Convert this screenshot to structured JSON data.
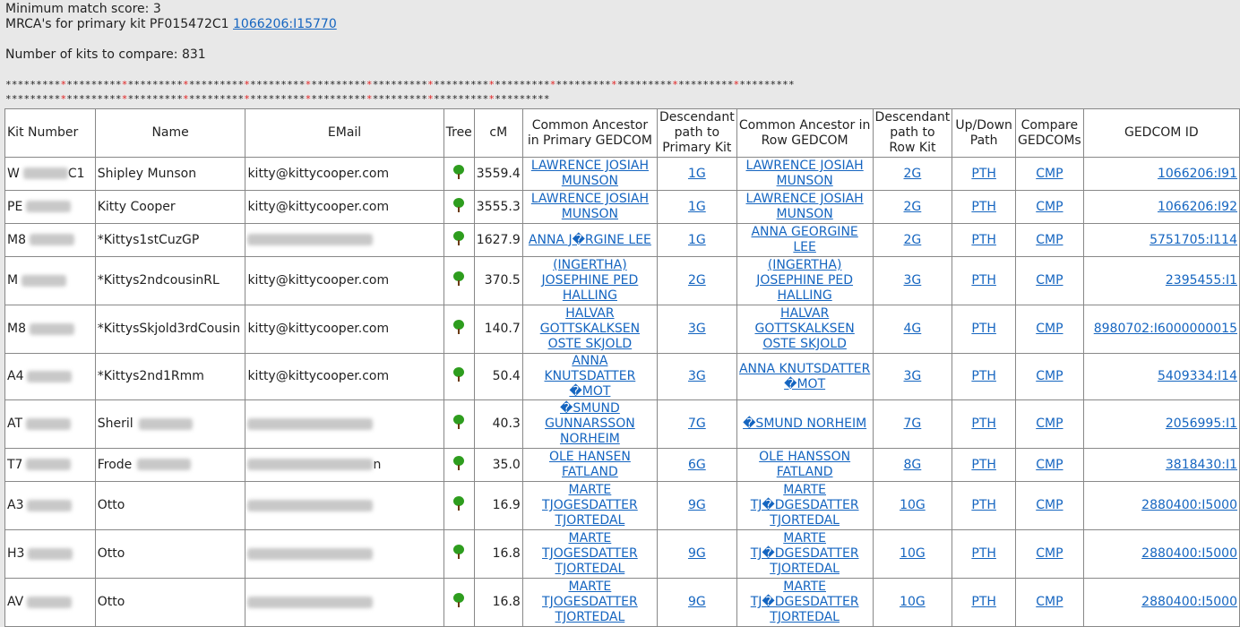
{
  "header": {
    "min_score_line": "Minimum match score: 3",
    "mrca_prefix": "MRCA's for primary kit PF015472C1",
    "mrca_link": "1066206:I15770",
    "kits_line": "Number of kits to compare: 831"
  },
  "stars": {
    "line1": "*********************************************************************************************************************************",
    "line2": "*****************************************************************************************"
  },
  "columns": {
    "kit": "Kit Number",
    "name": "Name",
    "email": "EMail",
    "tree": "Tree",
    "cm": "cM",
    "ca_primary": "Common Ancestor in Primary GEDCOM",
    "desc_primary": "Descendant path to Primary Kit",
    "ca_row": "Common Ancestor in Row GEDCOM",
    "desc_row": "Descendant path to Row Kit",
    "updown": "Up/Down Path",
    "compare": "Compare GEDCOMs",
    "gedcom_id": "GEDCOM ID"
  },
  "rows": [
    {
      "kit": "W",
      "kit_tail": "C1",
      "name": "Shipley Munson",
      "email": "kitty@kittycooper.com",
      "cm": "3559.4",
      "ca_primary": "LAWRENCE JOSIAH MUNSON",
      "desc_primary": "1G",
      "ca_row": "LAWRENCE JOSIAH MUNSON",
      "desc_row": "2G",
      "updown": "PTH",
      "compare": "CMP",
      "gedcom_id": "1066206:I91"
    },
    {
      "kit": "PE",
      "kit_tail": "",
      "name": "Kitty Cooper",
      "email": "kitty@kittycooper.com",
      "cm": "3555.3",
      "ca_primary": "LAWRENCE JOSIAH MUNSON",
      "desc_primary": "1G",
      "ca_row": "LAWRENCE JOSIAH MUNSON",
      "desc_row": "2G",
      "updown": "PTH",
      "compare": "CMP",
      "gedcom_id": "1066206:I92"
    },
    {
      "kit": "M8",
      "kit_tail": "",
      "name": "*Kittys1stCuzGP",
      "email": "",
      "cm": "1627.9",
      "ca_primary": "ANNA J�RGINE LEE",
      "desc_primary": "1G",
      "ca_row": "ANNA GEORGINE LEE",
      "desc_row": "2G",
      "updown": "PTH",
      "compare": "CMP",
      "gedcom_id": "5751705:I114"
    },
    {
      "kit": "M",
      "kit_tail": "",
      "name": "*Kittys2ndcousinRL",
      "email": "kitty@kittycooper.com",
      "cm": "370.5",
      "ca_primary": "(INGERTHA) JOSEPHINE PED HALLING",
      "desc_primary": "2G",
      "ca_row": "(INGERTHA) JOSEPHINE PED HALLING",
      "desc_row": "3G",
      "updown": "PTH",
      "compare": "CMP",
      "gedcom_id": "2395455:I1"
    },
    {
      "kit": "M8",
      "kit_tail": "",
      "name": "*KittysSkjold3rdCousin",
      "email": "kitty@kittycooper.com",
      "cm": "140.7",
      "ca_primary": "HALVAR GOTTSKALKSEN OSTE SKJOLD",
      "desc_primary": "3G",
      "ca_row": "HALVAR GOTTSKALKSEN OSTE SKJOLD",
      "desc_row": "4G",
      "updown": "PTH",
      "compare": "CMP",
      "gedcom_id": "8980702:I6000000015"
    },
    {
      "kit": "A4",
      "kit_tail": "",
      "name": "*Kittys2nd1Rmm",
      "email": "kitty@kittycooper.com",
      "cm": "50.4",
      "ca_primary": "ANNA KNUTSDATTER �MOT",
      "desc_primary": "3G",
      "ca_row": "ANNA KNUTSDATTER �MOT",
      "desc_row": "3G",
      "updown": "PTH",
      "compare": "CMP",
      "gedcom_id": "5409334:I14"
    },
    {
      "kit": "AT",
      "kit_tail": "",
      "name": "Sheril",
      "email": "",
      "cm": "40.3",
      "ca_primary": "�SMUND GUNNARSSON NORHEIM",
      "desc_primary": "7G",
      "ca_row": "�SMUND NORHEIM",
      "desc_row": "7G",
      "updown": "PTH",
      "compare": "CMP",
      "gedcom_id": "2056995:I1"
    },
    {
      "kit": "T7",
      "kit_tail": "",
      "name": "Frode",
      "email": "",
      "email_tail": "n",
      "cm": "35.0",
      "ca_primary": "OLE HANSEN FATLAND",
      "desc_primary": "6G",
      "ca_row": "OLE HANSSON FATLAND",
      "desc_row": "8G",
      "updown": "PTH",
      "compare": "CMP",
      "gedcom_id": "3818430:I1"
    },
    {
      "kit": "A3",
      "kit_tail": "",
      "name": "Otto",
      "email": "",
      "cm": "16.9",
      "ca_primary": "MARTE TJOGESDATTER TJORTEDAL",
      "desc_primary": "9G",
      "ca_row": "MARTE TJ�DGESDATTER TJORTEDAL",
      "desc_row": "10G",
      "updown": "PTH",
      "compare": "CMP",
      "gedcom_id": "2880400:I5000"
    },
    {
      "kit": "H3",
      "kit_tail": "",
      "name": "Otto",
      "email": "",
      "cm": "16.8",
      "ca_primary": "MARTE TJOGESDATTER TJORTEDAL",
      "desc_primary": "9G",
      "ca_row": "MARTE TJ�DGESDATTER TJORTEDAL",
      "desc_row": "10G",
      "updown": "PTH",
      "compare": "CMP",
      "gedcom_id": "2880400:I5000"
    },
    {
      "kit": "AV",
      "kit_tail": "",
      "name": "Otto",
      "email": "",
      "cm": "16.8",
      "ca_primary": "MARTE TJOGESDATTER TJORTEDAL",
      "desc_primary": "9G",
      "ca_row": "MARTE TJ�DGESDATTER TJORTEDAL",
      "desc_row": "10G",
      "updown": "PTH",
      "compare": "CMP",
      "gedcom_id": "2880400:I5000"
    }
  ],
  "colors": {
    "link": "#1565c0",
    "star_red": "#e02020",
    "tree_green": "#2e9d1e"
  }
}
